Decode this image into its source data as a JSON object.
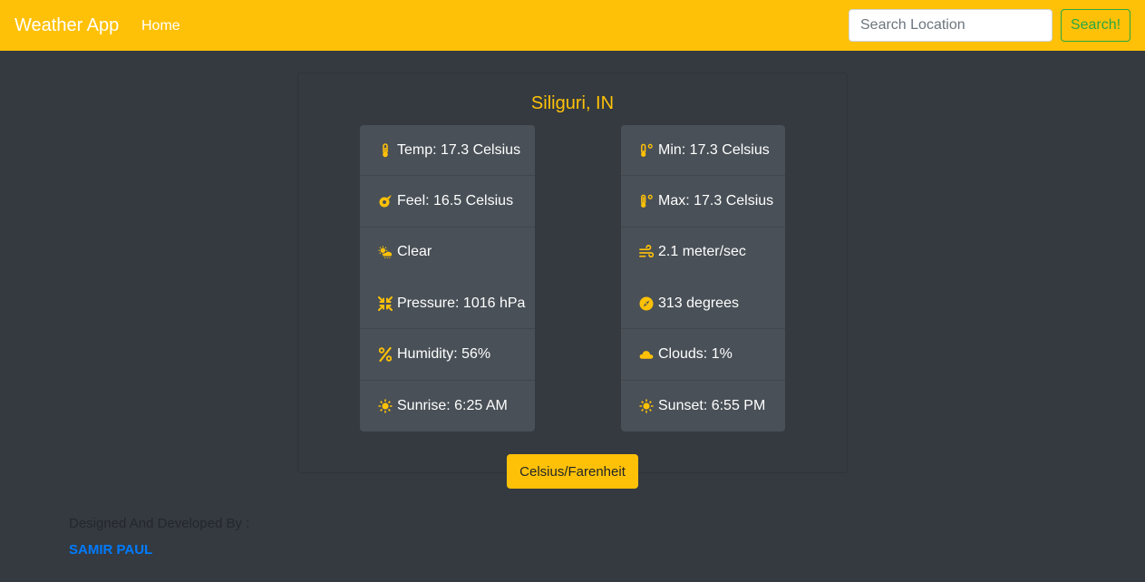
{
  "navbar": {
    "brand": "Weather App",
    "home": "Home",
    "search_placeholder": "Search Location",
    "search_button": "Search!"
  },
  "weather": {
    "location": "Siliguri, IN",
    "left": [
      {
        "icon": "thermometer-icon",
        "text": "Temp: 17.3 Celsius"
      },
      {
        "icon": "feel-icon",
        "text": "Feel: 16.5 Celsius"
      },
      {
        "icon": "cloud-sun-icon",
        "text": "Clear"
      },
      {
        "icon": "pressure-icon",
        "text": "Pressure: 1016 hPa"
      },
      {
        "icon": "percent-icon",
        "text": "Humidity: 56%"
      },
      {
        "icon": "sun-icon",
        "text": "Sunrise: 6:25 AM"
      }
    ],
    "right": [
      {
        "icon": "temperature-low-icon",
        "text": "Min: 17.3 Celsius"
      },
      {
        "icon": "temperature-high-icon",
        "text": "Max: 17.3 Celsius"
      },
      {
        "icon": "wind-icon",
        "text": "2.1 meter/sec"
      },
      {
        "icon": "compass-icon",
        "text": "313 degrees"
      },
      {
        "icon": "cloud-icon",
        "text": "Clouds: 1%"
      },
      {
        "icon": "sun-icon",
        "text": "Sunset: 6:55 PM"
      }
    ],
    "toggle_button": "Celsius/Farenheit"
  },
  "footer": {
    "credit": "Designed And Developed By :",
    "author": "SAMIR PAUL"
  },
  "colors": {
    "accent": "#ffc107",
    "background": "#343a40",
    "list_bg": "#495057",
    "search_green": "#28a745",
    "link_blue": "#007bff"
  }
}
